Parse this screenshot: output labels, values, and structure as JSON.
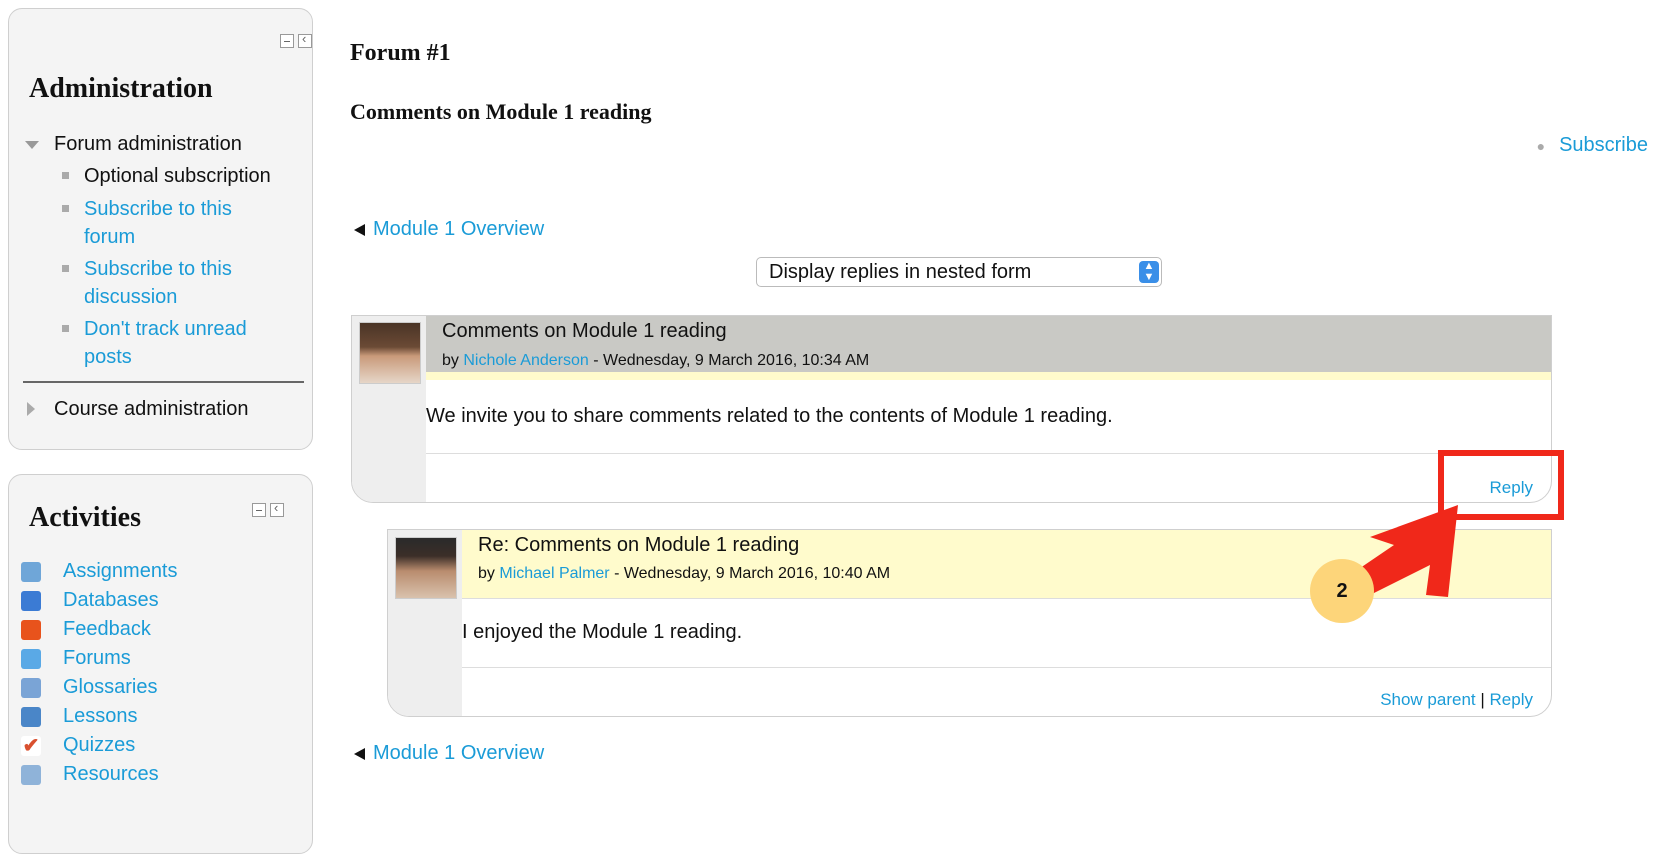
{
  "admin": {
    "title": "Administration",
    "forum_admin": "Forum administration",
    "items": [
      {
        "label": "Optional subscription"
      },
      {
        "line1": "Subscribe to this",
        "line2": "forum"
      },
      {
        "line1": "Subscribe to this",
        "line2": "discussion"
      },
      {
        "line1": "Don't track unread",
        "line2": "posts"
      }
    ],
    "course_admin": "Course administration"
  },
  "activities": {
    "title": "Activities",
    "items": [
      {
        "label": "Assignments",
        "icon": "assignment-icon",
        "color": "#6fa6d8"
      },
      {
        "label": "Databases",
        "icon": "database-icon",
        "color": "#3b7bd4"
      },
      {
        "label": "Feedback",
        "icon": "megaphone-icon",
        "color": "#e8531c"
      },
      {
        "label": "Forums",
        "icon": "forum-icon",
        "color": "#5aa9e6"
      },
      {
        "label": "Glossaries",
        "icon": "glossary-icon",
        "color": "#7aa4d6"
      },
      {
        "label": "Lessons",
        "icon": "lesson-icon",
        "color": "#4a86c8"
      },
      {
        "label": "Quizzes",
        "icon": "quiz-check-icon",
        "color": "#d9502f"
      },
      {
        "label": "Resources",
        "icon": "resource-icon",
        "color": "#8fb3d9"
      }
    ]
  },
  "main": {
    "title": "Forum #1",
    "discussion_title": "Comments on Module 1 reading",
    "subscribe": "Subscribe",
    "nav_link": "Module 1 Overview",
    "display_select": "Display replies in nested form"
  },
  "posts": [
    {
      "subject": "Comments on Module 1 reading",
      "by": "by",
      "author": "Nichole Anderson",
      "date": " - Wednesday, 9 March 2016, 10:34 AM",
      "content": "We invite you to share comments related to the contents of Module 1 reading.",
      "reply": "Reply"
    },
    {
      "subject": "Re: Comments on Module 1 reading",
      "by": "by",
      "author": "Michael Palmer",
      "date": " - Wednesday, 9 March 2016, 10:40 AM",
      "content": "I enjoyed the Module 1 reading.",
      "show_parent": "Show parent",
      "separator": "|",
      "reply": "Reply"
    }
  ],
  "annotation": {
    "step": "2"
  },
  "colors": {
    "link": "#1a9bd7",
    "callout": "#f0281a",
    "badge": "#fdd57a",
    "header_gray": "#c9c9c5",
    "header_yellow": "#fffbcc"
  }
}
